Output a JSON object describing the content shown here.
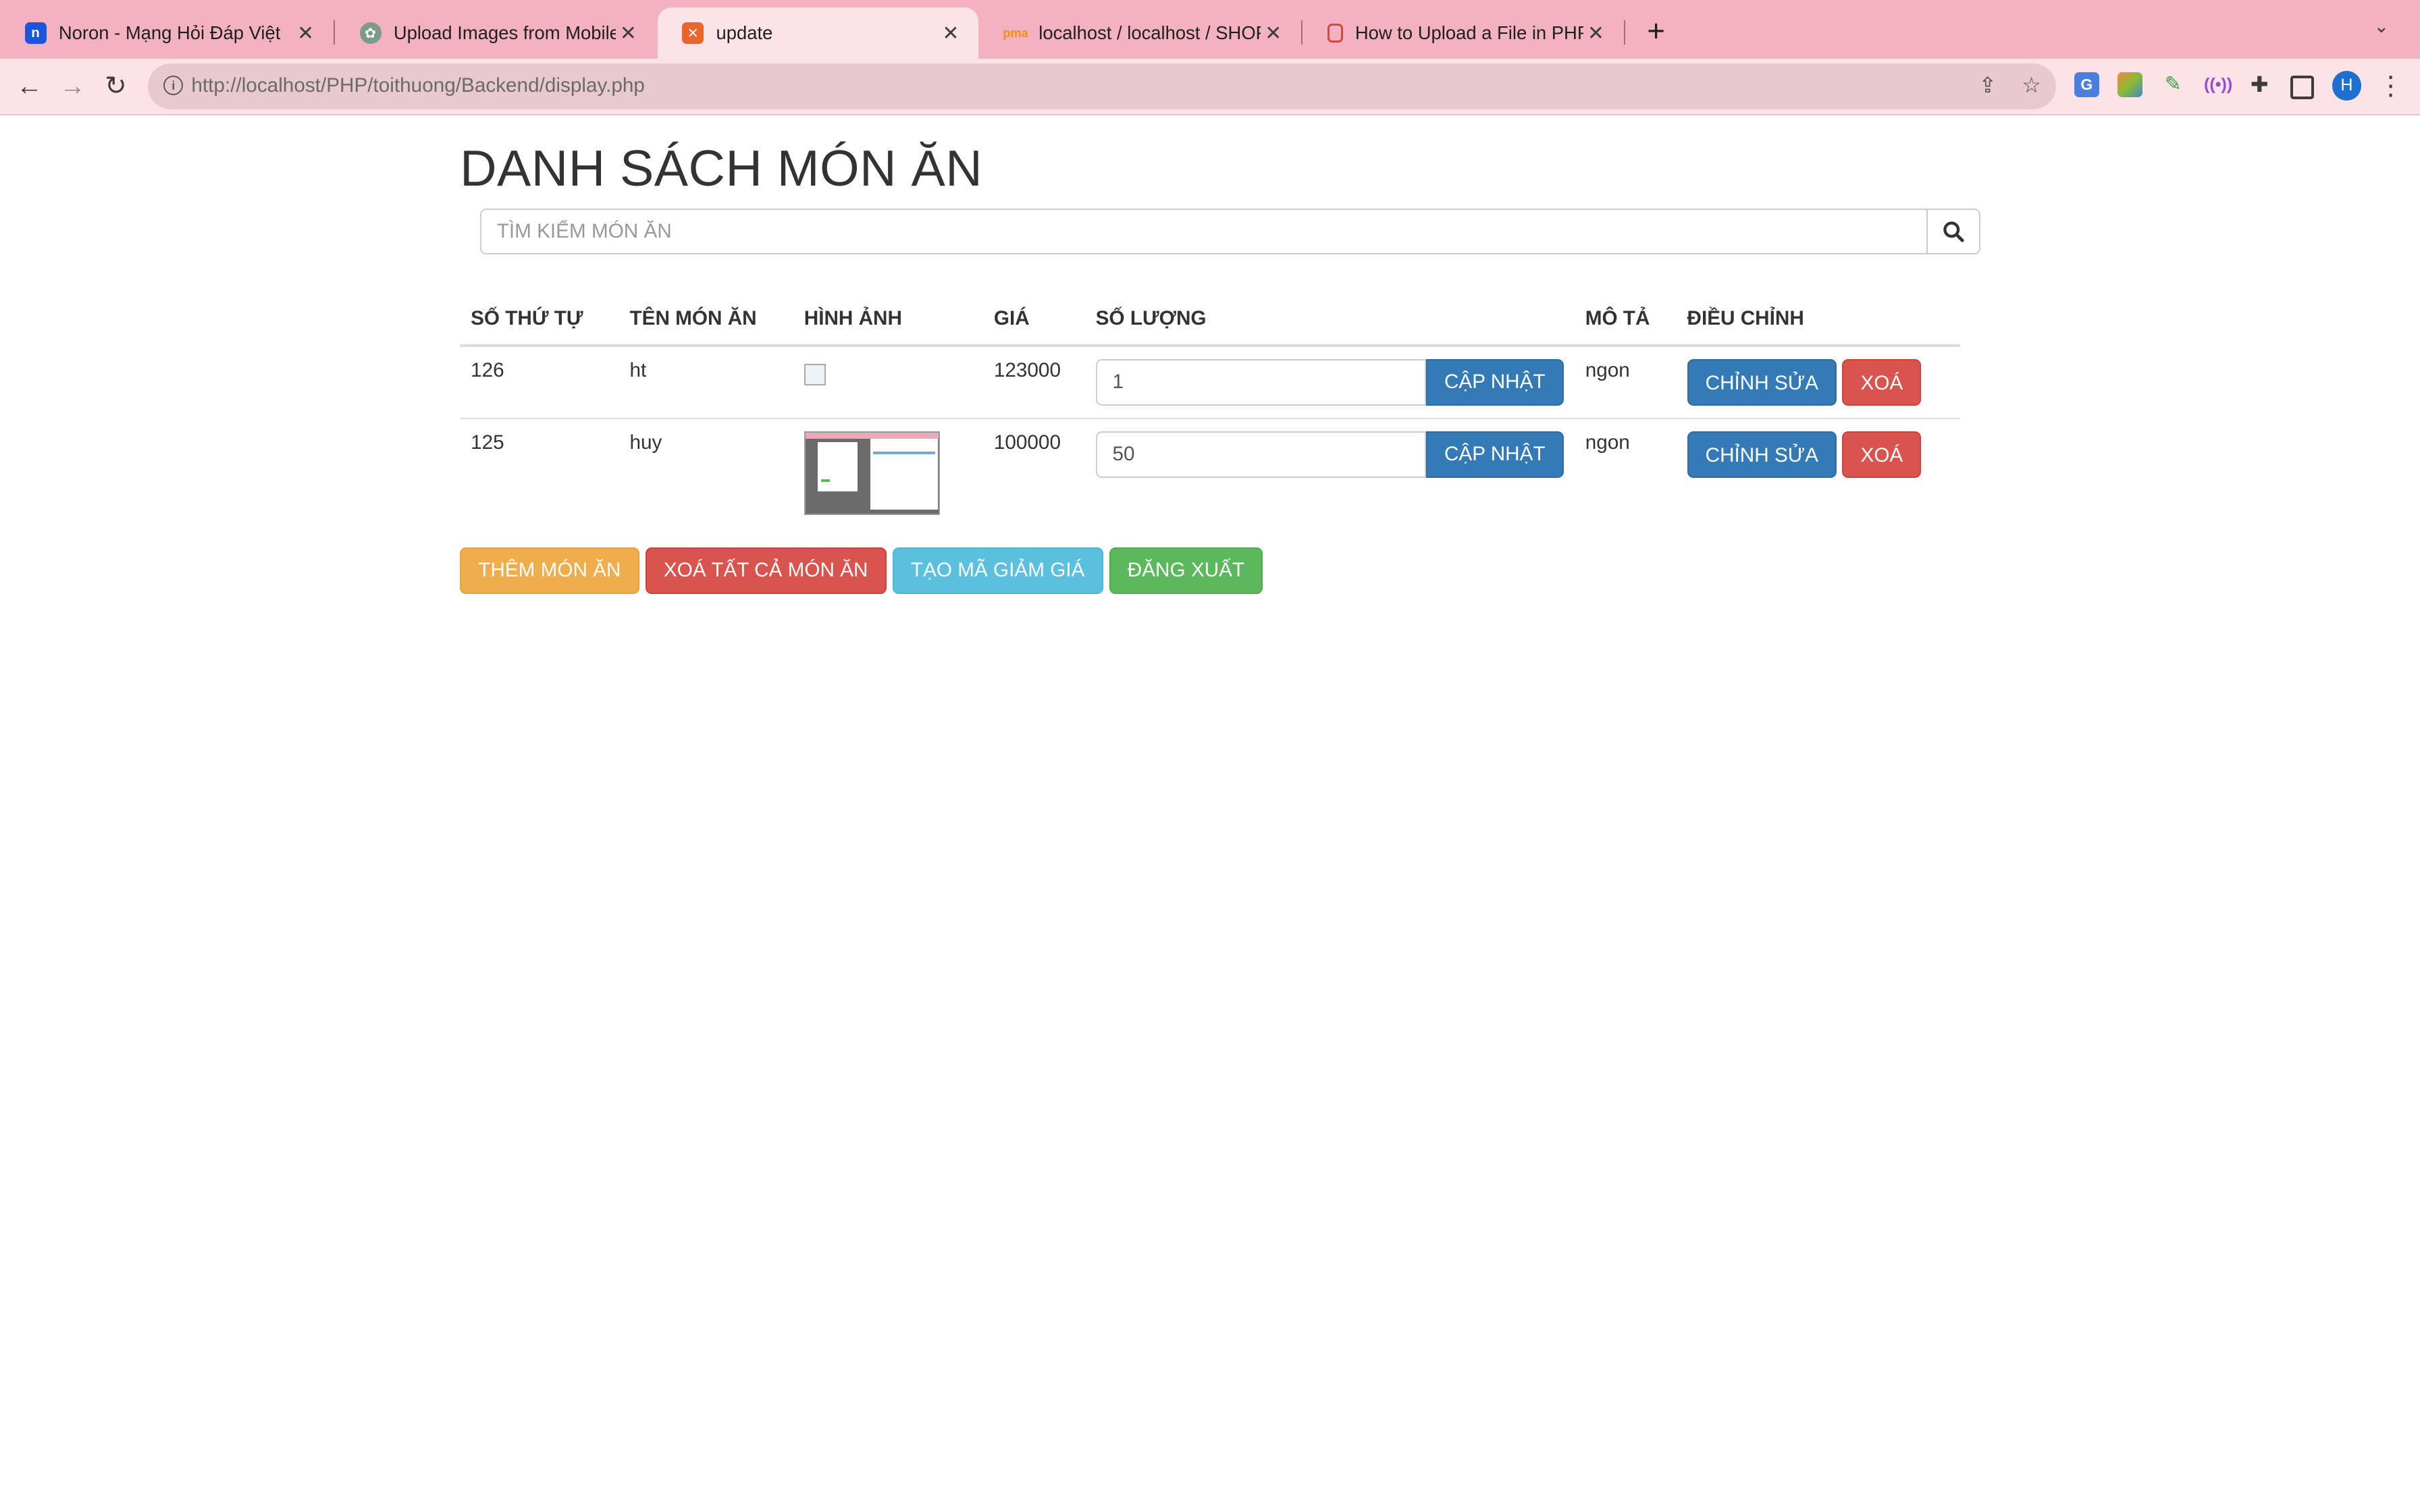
{
  "browser": {
    "tabs": [
      {
        "title": "Noron - Mạng Hỏi Đáp Việt",
        "favicon_color": "#1a56db",
        "icon": "noron-icon"
      },
      {
        "title": "Upload Images from Mobile",
        "favicon_color": "#7a9a8a",
        "icon": "openai-icon"
      },
      {
        "title": "update",
        "favicon_color": "#e8662c",
        "icon": "xampp-icon"
      },
      {
        "title": "localhost / localhost / SHOPEE",
        "favicon_color": "#f29111",
        "icon": "phpmyadmin-icon"
      },
      {
        "title": "How to Upload a File in PHP (W",
        "favicon_color": "#d44a3a",
        "icon": "document-icon"
      }
    ],
    "active_tab": 2,
    "url_host": "http://localhost",
    "url_path": "/PHP/toithuong/Backend/display.php",
    "avatar_letter": "H"
  },
  "page": {
    "title": "DANH SÁCH MÓN ĂN",
    "search_placeholder": "TÌM KIẾM MÓN ĂN",
    "columns": [
      "SỐ THỨ TỰ",
      "TÊN MÓN ĂN",
      "HÌNH ẢNH",
      "GIÁ",
      "SỐ LƯỢNG",
      "MÔ TẢ",
      "ĐIỀU CHỈNH"
    ],
    "update_label": "CẬP NHẬT",
    "edit_label": "CHỈNH SỬA",
    "delete_label": "XOÁ",
    "rows": [
      {
        "id": "126",
        "name": "ht",
        "image": "broken",
        "price": "123000",
        "quantity": "1",
        "description": "ngon"
      },
      {
        "id": "125",
        "name": "huy",
        "image": "screenshot-thumbnail",
        "price": "100000",
        "quantity": "50",
        "description": "ngon"
      }
    ],
    "actions": {
      "add": "THÊM MÓN ĂN",
      "delete_all": "XOÁ TẤT CẢ MÓN ĂN",
      "coupon": "TẠO MÃ GIẢM GIÁ",
      "logout": "ĐĂNG XUẤT"
    }
  }
}
